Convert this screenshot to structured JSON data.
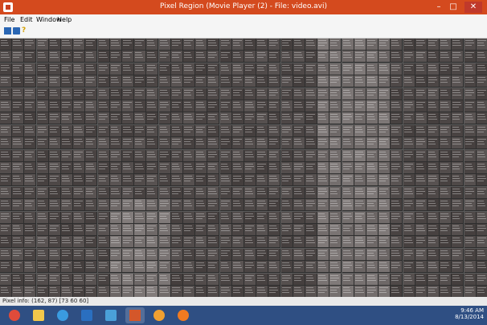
{
  "window": {
    "title": "Pixel Region (Movie Player (2) - File: video.avi)",
    "minimize_glyph": "–",
    "maximize_glyph": "□",
    "close_glyph": "✕"
  },
  "menu": {
    "file": "File",
    "edit": "Edit",
    "window": "Window",
    "help": "Help"
  },
  "toolbar": {
    "icons": [
      "copy-icon",
      "save-icon",
      "help-icon"
    ]
  },
  "status": {
    "pixel_info": "Pixel info: (162, 87) [73 60 60]"
  },
  "taskbar": {
    "apps": [
      "chrome-icon",
      "file-explorer-icon",
      "internet-explorer-icon",
      "outlook-icon",
      "mail-icon",
      "matlab-icon",
      "paint-icon",
      "firefox-icon"
    ],
    "time": "9:46 AM",
    "date": "8/13/2014"
  },
  "colors": {
    "titlebar": "#d44a1e",
    "taskbar": "#2f4f83"
  }
}
